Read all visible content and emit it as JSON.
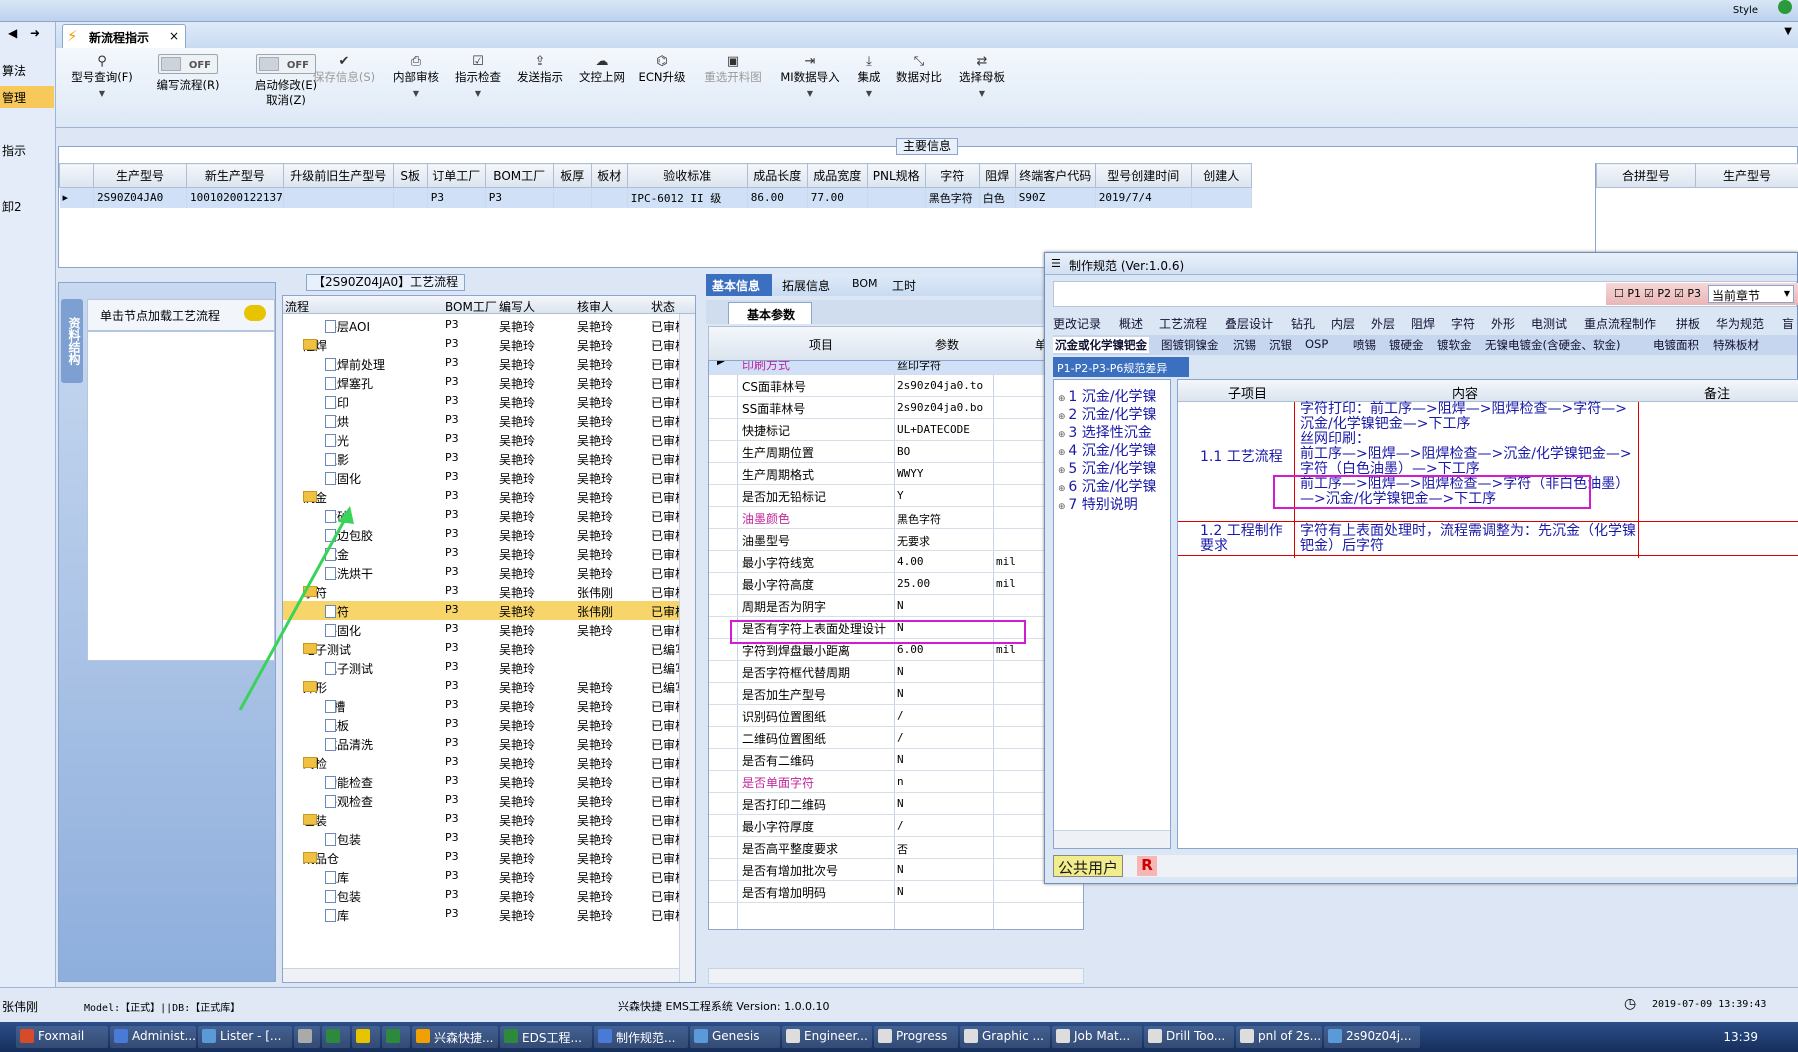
{
  "window": {
    "style_label": "Style"
  },
  "left_strip": [
    "算法",
    "管理",
    "指示",
    "卸2"
  ],
  "doc_tab": {
    "title": "新流程指示",
    "close": "×"
  },
  "ribbon": {
    "items": [
      {
        "label": "型号查询(F)",
        "icon": "search-icon"
      },
      {
        "label": "编写流程(R)",
        "toggle": "OFF"
      },
      {
        "label": "启动修改(E)",
        "sub": "取消(Z)",
        "toggle": "OFF"
      },
      {
        "label": "保存信息(S)",
        "icon": "check-icon",
        "disabled": true
      },
      {
        "label": "内部审核",
        "icon": "print-icon"
      },
      {
        "label": "指示检查",
        "icon": "check-icon"
      },
      {
        "label": "发送指示",
        "icon": "upload-icon"
      },
      {
        "label": "文控上网",
        "icon": "cloud-icon"
      },
      {
        "label": "ECN升级",
        "icon": "binoculars-icon"
      },
      {
        "label": "重选开料图",
        "icon": "image-icon",
        "disabled": true
      },
      {
        "label": "MI数据导入",
        "icon": "import-icon"
      },
      {
        "label": "集成",
        "icon": "download-icon"
      },
      {
        "label": "数据对比",
        "icon": "compare-icon"
      },
      {
        "label": "选择母板",
        "icon": "shuffle-icon"
      }
    ]
  },
  "main_info": {
    "title": "主要信息",
    "headers": [
      "生产型号",
      "新生产型号",
      "升级前旧生产型号",
      "S板",
      "订单工厂",
      "BOM工厂",
      "板厚",
      "板材",
      "验收标准",
      "成品长度",
      "成品宽度",
      "PNL规格",
      "字符",
      "阻焊",
      "终端客户代码",
      "型号创建时间",
      "创建人"
    ],
    "row": [
      "2S90Z04JA0",
      "10010200122137",
      "",
      "",
      "P3",
      "P3",
      "",
      "",
      "IPC-6012 II 级",
      "86.00",
      "77.00",
      "",
      "黑色字符",
      "白色",
      "S90Z",
      "2019/7/4",
      ""
    ],
    "right_headers": [
      "合拼型号",
      "生产型号"
    ]
  },
  "process": {
    "vertical_tab": "资料结构",
    "node_hint": "单击节点加载工艺流程",
    "title": "【2S90Z04JA0】工艺流程",
    "headers": [
      "流程",
      "BOM工厂",
      "编写人",
      "核审人",
      "状态"
    ],
    "rows": [
      {
        "lvl": 2,
        "name": "外层AOI",
        "f": "P3",
        "w": "吴艳玲",
        "r": "吴艳玲",
        "s": "已审核"
      },
      {
        "lvl": 1,
        "name": "阻焊",
        "f": "P3",
        "w": "吴艳玲",
        "r": "吴艳玲",
        "s": "已审核"
      },
      {
        "lvl": 2,
        "name": "阻焊前处理",
        "f": "P3",
        "w": "吴艳玲",
        "r": "吴艳玲",
        "s": "已审核"
      },
      {
        "lvl": 2,
        "name": "阻焊塞孔",
        "f": "P3",
        "w": "吴艳玲",
        "r": "吴艳玲",
        "s": "已审核"
      },
      {
        "lvl": 2,
        "name": "丝印",
        "f": "P3",
        "w": "吴艳玲",
        "r": "吴艳玲",
        "s": "已审核"
      },
      {
        "lvl": 2,
        "name": "预烘",
        "f": "P3",
        "w": "吴艳玲",
        "r": "吴艳玲",
        "s": "已审核"
      },
      {
        "lvl": 2,
        "name": "曝光",
        "f": "P3",
        "w": "吴艳玲",
        "r": "吴艳玲",
        "s": "已审核"
      },
      {
        "lvl": 2,
        "name": "显影",
        "f": "P3",
        "w": "吴艳玲",
        "r": "吴艳玲",
        "s": "已审核"
      },
      {
        "lvl": 2,
        "name": "终固化",
        "f": "P3",
        "w": "吴艳玲",
        "r": "吴艳玲",
        "s": "已审核"
      },
      {
        "lvl": 1,
        "name": "沉金",
        "f": "P3",
        "w": "吴艳玲",
        "r": "吴艳玲",
        "s": "已审核"
      },
      {
        "lvl": 2,
        "name": "喷砂",
        "f": "P3",
        "w": "吴艳玲",
        "r": "吴艳玲",
        "s": "已审核"
      },
      {
        "lvl": 2,
        "name": "板边包胶",
        "f": "P3",
        "w": "吴艳玲",
        "r": "吴艳玲",
        "s": "已审核"
      },
      {
        "lvl": 2,
        "name": "沉金",
        "f": "P3",
        "w": "吴艳玲",
        "r": "吴艳玲",
        "s": "已审核"
      },
      {
        "lvl": 2,
        "name": "水洗烘干",
        "f": "P3",
        "w": "吴艳玲",
        "r": "吴艳玲",
        "s": "已审核"
      },
      {
        "lvl": 1,
        "name": "字符",
        "f": "P3",
        "w": "吴艳玲",
        "r": "张伟刚",
        "s": "已审核"
      },
      {
        "lvl": 2,
        "name": "字符",
        "f": "P3",
        "w": "吴艳玲",
        "r": "张伟刚",
        "s": "已审核",
        "sel": true
      },
      {
        "lvl": 2,
        "name": "终固化",
        "f": "P3",
        "w": "吴艳玲",
        "r": "吴艳玲",
        "s": "已审核"
      },
      {
        "lvl": 1,
        "name": "电子测试",
        "f": "P3",
        "w": "吴艳玲",
        "r": "",
        "s": "已编写"
      },
      {
        "lvl": 2,
        "name": "电子测试",
        "f": "P3",
        "w": "吴艳玲",
        "r": "",
        "s": "已编写"
      },
      {
        "lvl": 1,
        "name": "外形",
        "f": "P3",
        "w": "吴艳玲",
        "r": "吴艳玲",
        "s": "已编写"
      },
      {
        "lvl": 2,
        "name": "V槽",
        "f": "P3",
        "w": "吴艳玲",
        "r": "吴艳玲",
        "s": "已审核"
      },
      {
        "lvl": 2,
        "name": "铣板",
        "f": "P3",
        "w": "吴艳玲",
        "r": "吴艳玲",
        "s": "已审核"
      },
      {
        "lvl": 2,
        "name": "成品清洗",
        "f": "P3",
        "w": "吴艳玲",
        "r": "吴艳玲",
        "s": "已审核"
      },
      {
        "lvl": 1,
        "name": "终检",
        "f": "P3",
        "w": "吴艳玲",
        "r": "吴艳玲",
        "s": "已审核"
      },
      {
        "lvl": 2,
        "name": "功能检查",
        "f": "P3",
        "w": "吴艳玲",
        "r": "吴艳玲",
        "s": "已审核"
      },
      {
        "lvl": 2,
        "name": "外观检查",
        "f": "P3",
        "w": "吴艳玲",
        "r": "吴艳玲",
        "s": "已审核"
      },
      {
        "lvl": 1,
        "name": "包装",
        "f": "P3",
        "w": "吴艳玲",
        "r": "吴艳玲",
        "s": "已审核"
      },
      {
        "lvl": 2,
        "name": "内包装",
        "f": "P3",
        "w": "吴艳玲",
        "r": "吴艳玲",
        "s": "已审核"
      },
      {
        "lvl": 1,
        "name": "成品仓",
        "f": "P3",
        "w": "吴艳玲",
        "r": "吴艳玲",
        "s": "已审核"
      },
      {
        "lvl": 2,
        "name": "入库",
        "f": "P3",
        "w": "吴艳玲",
        "r": "吴艳玲",
        "s": "已审核"
      },
      {
        "lvl": 2,
        "name": "外包装",
        "f": "P3",
        "w": "吴艳玲",
        "r": "吴艳玲",
        "s": "已审核"
      },
      {
        "lvl": 2,
        "name": "出库",
        "f": "P3",
        "w": "吴艳玲",
        "r": "吴艳玲",
        "s": "已审核"
      }
    ]
  },
  "params": {
    "tabs": [
      "基本信息",
      "拓展信息",
      "BOM",
      "工时"
    ],
    "subtab": "基本参数",
    "headers": [
      "项目",
      "参数",
      "单"
    ],
    "rows": [
      {
        "k": "印刷方式",
        "v": "丝印字符",
        "u": "",
        "pink": true,
        "sel": true
      },
      {
        "k": "CS面菲林号",
        "v": "2s90z04ja0.to",
        "u": ""
      },
      {
        "k": "SS面菲林号",
        "v": "2s90z04ja0.bo",
        "u": ""
      },
      {
        "k": "快捷标记",
        "v": "UL+DATECODE",
        "u": ""
      },
      {
        "k": "生产周期位置",
        "v": "BO",
        "u": ""
      },
      {
        "k": "生产周期格式",
        "v": "WWYY",
        "u": ""
      },
      {
        "k": "是否加无铅标记",
        "v": "Y",
        "u": ""
      },
      {
        "k": "油墨颜色",
        "v": "黑色字符",
        "u": "",
        "pink": true
      },
      {
        "k": "油墨型号",
        "v": "无要求",
        "u": ""
      },
      {
        "k": "最小字符线宽",
        "v": "4.00",
        "u": "mil"
      },
      {
        "k": "最小字符高度",
        "v": "25.00",
        "u": "mil"
      },
      {
        "k": "周期是否为阴字",
        "v": "N",
        "u": ""
      },
      {
        "k": "是否有字符上表面处理设计",
        "v": "N",
        "u": ""
      },
      {
        "k": "字符到焊盘最小距离",
        "v": "6.00",
        "u": "mil"
      },
      {
        "k": "是否字符框代替周期",
        "v": "N",
        "u": ""
      },
      {
        "k": "是否加生产型号",
        "v": "N",
        "u": ""
      },
      {
        "k": "识别码位置图纸",
        "v": "/",
        "u": ""
      },
      {
        "k": "二维码位置图纸",
        "v": "/",
        "u": ""
      },
      {
        "k": "是否有二维码",
        "v": "N",
        "u": ""
      },
      {
        "k": "是否单面字符",
        "v": "n",
        "u": "",
        "pink": true
      },
      {
        "k": "是否打印二维码",
        "v": "N",
        "u": ""
      },
      {
        "k": "最小字符厚度",
        "v": "/",
        "u": ""
      },
      {
        "k": "是否高平整度要求",
        "v": "否",
        "u": ""
      },
      {
        "k": "是否有增加批次号",
        "v": "N",
        "u": ""
      },
      {
        "k": "是否有增加明码",
        "v": "N",
        "u": ""
      }
    ]
  },
  "dialog": {
    "title": "制作规范 (Ver:1.0.6)",
    "checks": [
      "P1",
      "P2",
      "P3"
    ],
    "section_select": "当前章节",
    "tabs1": [
      "更改记录",
      "概述",
      "工艺流程",
      "叠层设计",
      "钻孔",
      "内层",
      "外层",
      "阻焊",
      "字符",
      "外形",
      "电测试",
      "重点流程制作",
      "拼板",
      "华为规范",
      "盲孔"
    ],
    "tabs2": [
      "沉金或化学镍钯金",
      "图镀铜镍金",
      "沉锡",
      "沉银",
      "OSP",
      "喷锡",
      "镀硬金",
      "镀软金",
      "无镍电镀金(含硬金、软金)",
      "电镀面积",
      "特殊板材"
    ],
    "diff_tab": "P1-P2-P3-P6规范差异",
    "tree": [
      "1 沉金/化学镍",
      "2 沉金/化学镍",
      "3 选择性沉金",
      "4 沉金/化学镍",
      "5 沉金/化学镍",
      "6 沉金/化学镍",
      "7 特别说明"
    ],
    "headers": [
      "子项目",
      "内容",
      "备注"
    ],
    "r1_label": "1.1 工艺流程",
    "r1_lines": [
      "字符打印：前工序—>阻焊—>阻焊检查—>字符—>沉金/化学镍钯金—>下工序",
      "丝网印刷：",
      "前工序—>阻焊—>阻焊检查—>沉金/化学镍钯金—>字符（白色油墨）—>下工序",
      "前工序—>阻焊—>阻焊检查—>字符（非白色油墨）—>沉金/化学镍钯金—>下工序"
    ],
    "r2_label": "1.2 工程制作要求",
    "r2_content": "字符有上表面处理时，流程需调整为：先沉金（化学镍钯金）后字符",
    "user": "公共用户",
    "user_badge": "R"
  },
  "status": {
    "user": "张伟刚",
    "model": "Model:【正式】||DB:【正式库】",
    "system": "兴森快捷 EMS工程系统 Version: 1.0.0.10",
    "datetime": "2019-07-09 13:39:43"
  },
  "taskbar": {
    "items": [
      "Foxmail",
      "Administ...",
      "Lister - [...",
      "",
      "",
      "",
      "",
      "兴森快捷...",
      "EDS工程...",
      "制作规范...",
      "Genesis",
      "Engineer...",
      "Progress",
      "Graphic ...",
      "Job Mat...",
      "Drill Too...",
      "pnl of 2s...",
      "2s90z04j..."
    ],
    "clock": "13:39"
  },
  "colors": {
    "accent": "#d21ccf",
    "selection": "#f7d56b",
    "pink_text": "#c0269a",
    "tree_blue": "#1a1aa8"
  }
}
